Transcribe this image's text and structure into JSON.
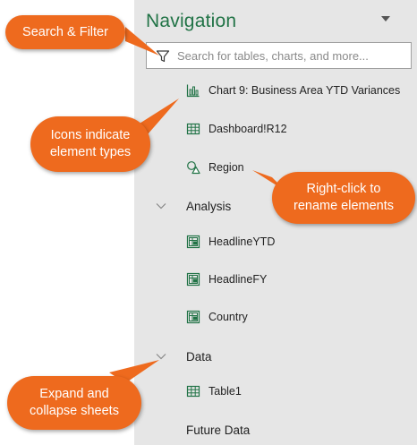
{
  "navigation": {
    "title": "Navigation",
    "search": {
      "placeholder": "Search for tables, charts, and more...",
      "value": ""
    },
    "top_items": [
      {
        "label": "Chart 9: Business Area YTD Variances",
        "icon": "bar-chart-icon"
      },
      {
        "label": "Dashboard!R12",
        "icon": "table-grid-icon"
      },
      {
        "label": "Region",
        "icon": "shapes-icon"
      }
    ],
    "sheets": [
      {
        "label": "Analysis",
        "expanded": true,
        "items": [
          {
            "label": "HeadlineYTD",
            "icon": "named-range-icon"
          },
          {
            "label": "HeadlineFY",
            "icon": "named-range-icon"
          },
          {
            "label": "Country",
            "icon": "named-range-icon"
          }
        ]
      },
      {
        "label": "Data",
        "expanded": true,
        "items": [
          {
            "label": "Table1",
            "icon": "table-grid-icon"
          }
        ]
      },
      {
        "label": "Future Data",
        "expanded": false,
        "items": []
      }
    ]
  },
  "callouts": {
    "search": "Search & Filter",
    "icons_line1": "Icons indicate",
    "icons_line2": "element types",
    "rename_line1": "Right-click to",
    "rename_line2": "rename elements",
    "expand_line1": "Expand and",
    "expand_line2": "collapse sheets"
  },
  "colors": {
    "accent_green": "#217346",
    "callout_orange": "#ee6a1e",
    "pane_background": "#e6e6e6"
  }
}
